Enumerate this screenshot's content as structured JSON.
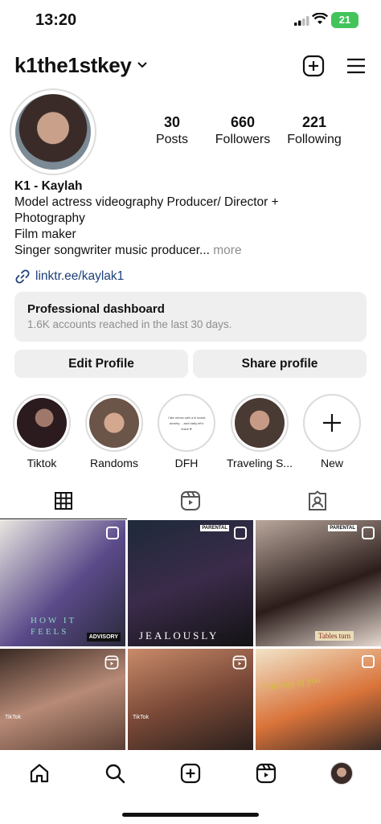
{
  "status": {
    "time": "13:20",
    "battery": "21"
  },
  "profile": {
    "username": "k1the1stkey",
    "stats": [
      {
        "num": "30",
        "label": "Posts"
      },
      {
        "num": "660",
        "label": "Followers"
      },
      {
        "num": "221",
        "label": "Following"
      }
    ],
    "name": "K1 - Kaylah",
    "bio_lines": [
      "Model actress videography Producer/ Director +",
      "Photography",
      "Film maker",
      "Singer songwriter music producer..."
    ],
    "more": "more",
    "link": "linktr.ee/kaylak1"
  },
  "dashboard": {
    "title": "Professional dashboard",
    "subtitle": "1.6K accounts reached in the last 30 days."
  },
  "buttons": {
    "edit": "Edit Profile",
    "share": "Share profile"
  },
  "highlights": [
    {
      "label": "Tiktok",
      "color": "#2b1a1e"
    },
    {
      "label": "Randoms",
      "color": "#6b5548"
    },
    {
      "label": "DFH",
      "color": "#ffffff",
      "text": "I like mines with a lil social anxiety. ...and baby let's leave ♥"
    },
    {
      "label": "Traveling S...",
      "color": "#4a3a34"
    },
    {
      "label": "New",
      "color": "#ffffff"
    }
  ],
  "posts": [
    {
      "bg": "linear-gradient(135deg,#e8e6e0,#5b4a8a 55%,#2a2a3a)",
      "overlay": "HOW IT FEELS",
      "badge": "ADVISORY"
    },
    {
      "bg": "linear-gradient(160deg,#1e2a3a,#3b2b4a 50%,#121212)",
      "overlay": "JEALOUSLY",
      "badge": "PARENTAL"
    },
    {
      "bg": "linear-gradient(160deg,#b9a79c,#2b1c1a 55%,#e6d9cf)",
      "overlay": "Tables turn",
      "badge": "PARENTAL"
    },
    {
      "bg": "linear-gradient(160deg,#3a2a24,#b78a76 50%,#5b3f34)",
      "overlay": "TikTok",
      "badge": ""
    },
    {
      "bg": "linear-gradient(160deg,#c98b6a,#7b4a38 50%,#2a1f1c)",
      "overlay": "TikTok",
      "badge": ""
    },
    {
      "bg": "linear-gradient(160deg,#f1e4c8,#d9733a 55%,#3b2b26)",
      "overlay": "Thinking of you",
      "badge": ""
    }
  ],
  "colors": {
    "accent": "#0095f6",
    "link": "#1c3f7a",
    "muted": "#8e8e8e",
    "button_bg": "#efefef"
  },
  "icons": {
    "grid": "grid-icon",
    "reels": "reels-icon",
    "tagged": "tagged-icon",
    "home": "home-icon",
    "search": "search-icon",
    "create": "create-icon"
  }
}
